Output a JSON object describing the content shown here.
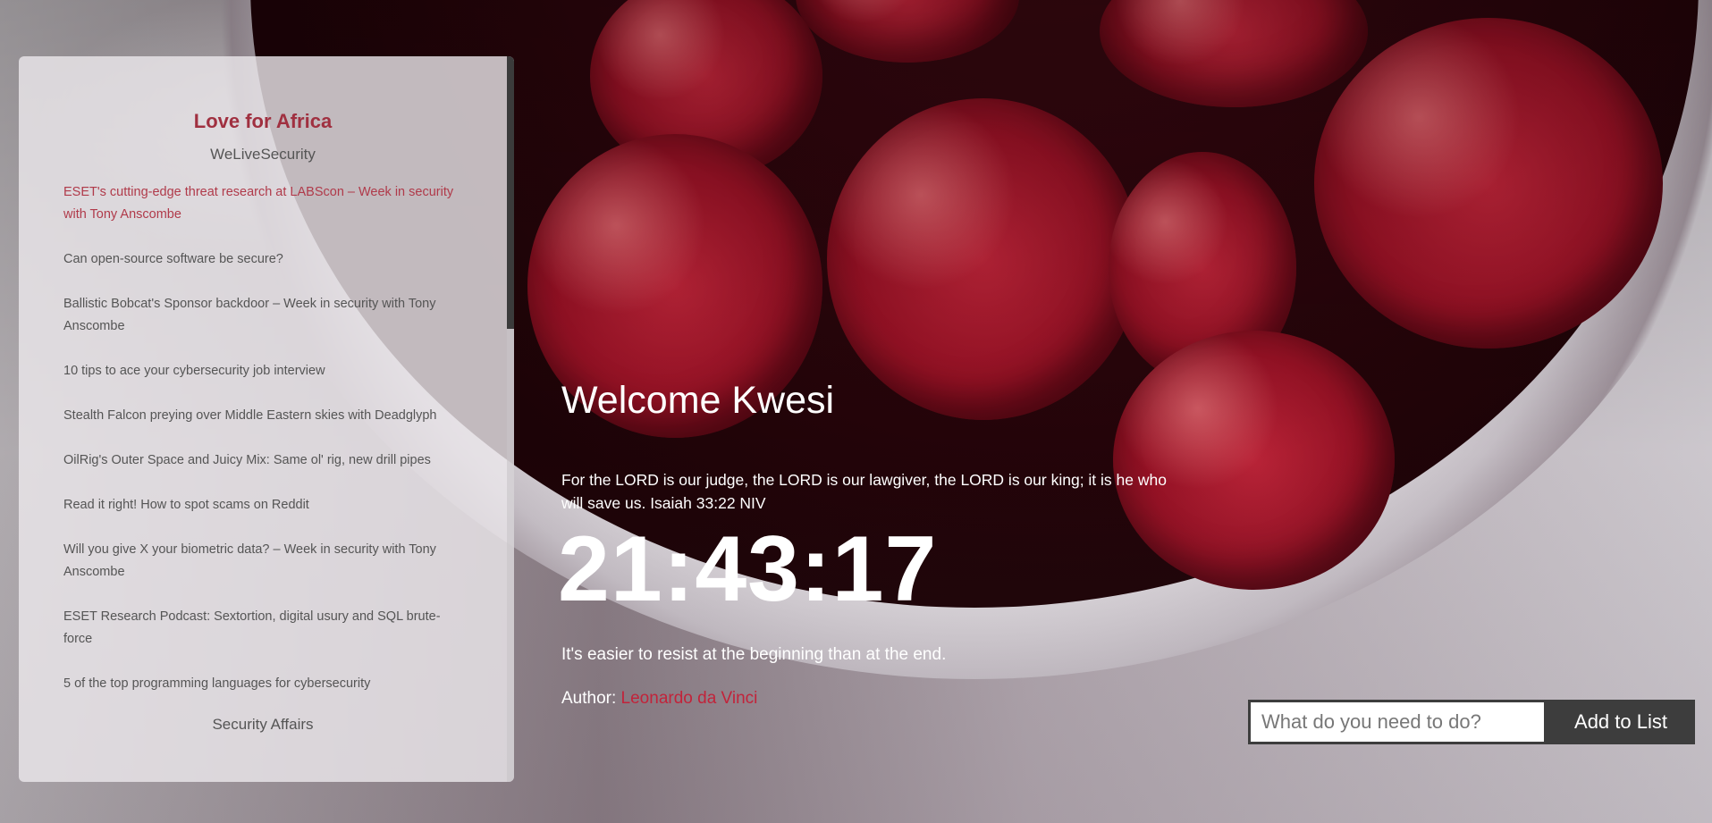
{
  "sidebar": {
    "title": "Love for Africa",
    "feeds": [
      {
        "source": "WeLiveSecurity",
        "items": [
          "ESET's cutting-edge threat research at LABScon – Week in security with Tony Anscombe",
          "Can open-source software be secure?",
          "Ballistic Bobcat's Sponsor backdoor – Week in security with Tony Anscombe",
          "10 tips to ace your cybersecurity job interview",
          "Stealth Falcon preying over Middle Eastern skies with Deadglyph",
          "OilRig's Outer Space and Juicy Mix: Same ol' rig, new drill pipes",
          "Read it right! How to spot scams on Reddit",
          "Will you give X your biometric data? – Week in security with Tony Anscombe",
          "ESET Research Podcast: Sextortion, digital usury and SQL brute-force",
          "5 of the top programming languages for cybersecurity"
        ]
      },
      {
        "source": "Security Affairs"
      }
    ]
  },
  "main": {
    "welcome": "Welcome Kwesi",
    "verse": "For the LORD is our judge, the LORD is our lawgiver, the LORD is our king; it is he who will save us. Isaiah 33:22 NIV",
    "clock": "21:43:17",
    "quote": "It's easier to resist at the beginning than at the end.",
    "author_label": "Author: ",
    "author_name": "Leonardo da Vinci"
  },
  "todo": {
    "placeholder": "What do you need to do?",
    "button_label": "Add to List"
  },
  "colors": {
    "accent": "#c2233a",
    "sidebar_title": "#a03040",
    "button_bg": "#3d3d3d"
  }
}
